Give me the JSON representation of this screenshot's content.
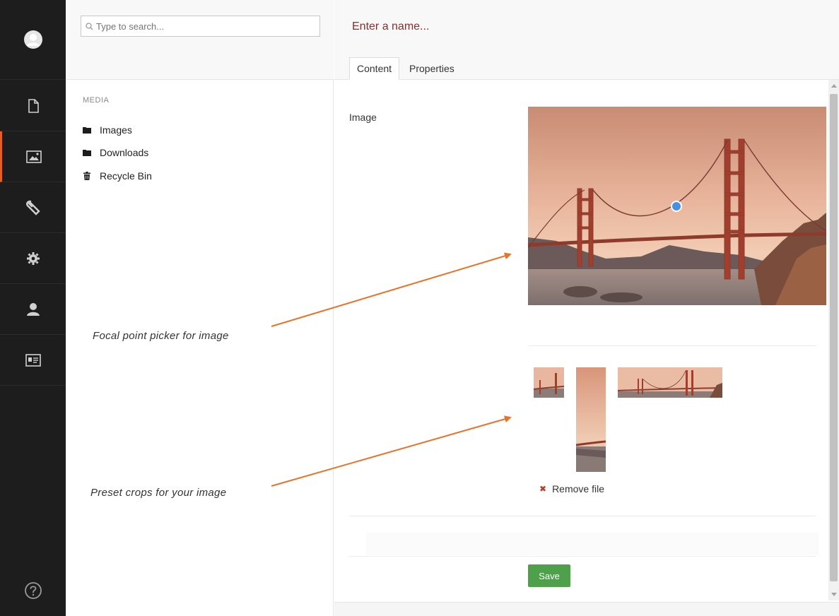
{
  "rail": {
    "items": [
      {
        "name": "content",
        "icon": "document-icon"
      },
      {
        "name": "media",
        "icon": "image-icon",
        "active": true
      },
      {
        "name": "developer",
        "icon": "wrench-icon"
      },
      {
        "name": "settings",
        "icon": "gear-icon"
      },
      {
        "name": "users",
        "icon": "user-icon"
      },
      {
        "name": "members",
        "icon": "id-card-icon"
      }
    ],
    "help_icon": "help-icon",
    "accent": "#e65f1e"
  },
  "tree": {
    "search_placeholder": "Type to search...",
    "section_title": "MEDIA",
    "items": [
      {
        "label": "Images",
        "icon": "folder-icon"
      },
      {
        "label": "Downloads",
        "icon": "folder-icon"
      },
      {
        "label": "Recycle Bin",
        "icon": "trash-icon"
      }
    ]
  },
  "annotations": {
    "focal": "Focal point picker for image",
    "crops": "Preset crops for your image",
    "arrow_color": "#e8732a"
  },
  "editor": {
    "name_placeholder": "Enter a name...",
    "tabs": [
      {
        "label": "Content",
        "active": true
      },
      {
        "label": "Properties",
        "active": false
      }
    ],
    "property_label": "Image",
    "remove_label": "Remove file",
    "save_label": "Save",
    "save_color": "#4ea04a",
    "focal_color": "#4a90e2"
  }
}
